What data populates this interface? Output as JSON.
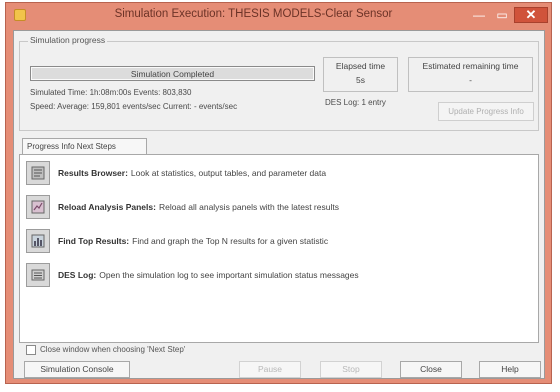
{
  "window": {
    "title": "Simulation Execution: THESIS MODELS-Clear Sensor",
    "minimize_glyph": "—",
    "maximize_glyph": "▭",
    "close_glyph": "✕"
  },
  "progress": {
    "group_label": "Simulation progress",
    "bar_label": "Simulation Completed",
    "fraction": 1.0,
    "simulated_time": "Simulated Time: 1h:08m:00s  Events: 803,830",
    "speed": "Speed: Average: 159,801 events/sec  Current:  - events/sec",
    "des_log": "DES Log: 1 entry",
    "elapsed_title": "Elapsed time",
    "elapsed_value": "5s",
    "remaining_title": "Estimated remaining time",
    "remaining_value": "-",
    "update_button": "Update Progress Info"
  },
  "tab": {
    "label": "Progress Info  Next Steps"
  },
  "steps": [
    {
      "icon": "results-browser-icon",
      "title": "Results Browser:",
      "desc": "Look at statistics, output tables, and parameter data"
    },
    {
      "icon": "reload-panels-icon",
      "title": "Reload Analysis Panels:",
      "desc": "Reload all analysis panels with the latest results"
    },
    {
      "icon": "top-results-icon",
      "title": "Find Top Results:",
      "desc": "Find and graph the Top N results for a given statistic"
    },
    {
      "icon": "des-log-icon",
      "title": "DES Log:",
      "desc": "Open the simulation log to see important simulation status messages"
    }
  ],
  "close_on_next_label": "Close window when choosing 'Next Step'",
  "footer": {
    "console": "Simulation Console",
    "pause": "Pause",
    "stop": "Stop",
    "close": "Close",
    "help": "Help"
  },
  "colors": {
    "titlebar": "#e58d76",
    "close_button": "#d0533b",
    "client": "#f0f0f0"
  }
}
